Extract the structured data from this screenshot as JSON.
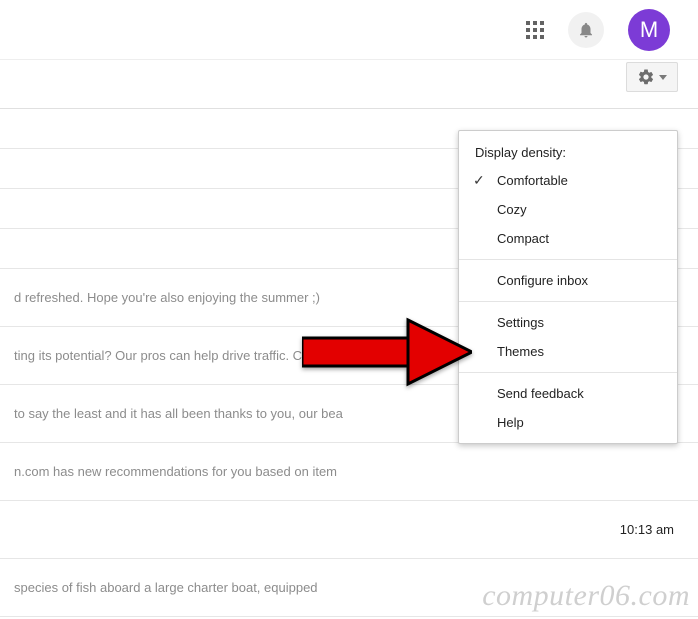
{
  "header": {
    "avatar_initial": "M"
  },
  "menu": {
    "header": "Display density:",
    "density": {
      "comfortable": "Comfortable",
      "cozy": "Cozy",
      "compact": "Compact"
    },
    "configure_inbox": "Configure inbox",
    "settings": "Settings",
    "themes": "Themes",
    "send_feedback": "Send feedback",
    "help": "Help"
  },
  "mail": {
    "rows": [
      "",
      "",
      "",
      "",
      "d refreshed. Hope you're also enjoying the summer ;)",
      "ting its potential? Our pros can help drive traffic. Con",
      "to say the least and it has all been thanks to you, our bea",
      "n.com has new recommendations for you based on item",
      "",
      "species of fish aboard a large charter boat, equipped"
    ],
    "times": {
      "8": "10:13 am"
    }
  },
  "watermark": "computer06.com"
}
